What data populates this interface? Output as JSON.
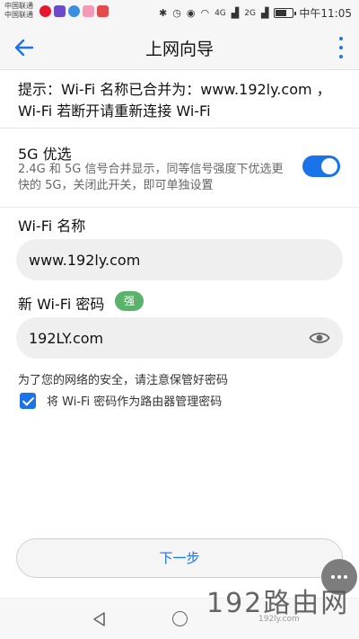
{
  "status_bar": {
    "carrier_1": "中国联通",
    "carrier_2": "中国联通",
    "network_1": "4G",
    "network_2": "2G",
    "time": "中午11:05"
  },
  "app_bar": {
    "title": "上网向导",
    "back_icon": "arrow-left-icon",
    "menu_icon": "more-vertical-icon"
  },
  "tip": "提示：Wi-Fi 名称已合并为：www.192ly.com ，Wi-Fi 若断开请重新连接 Wi-Fi",
  "option_5g": {
    "title": "5G 优选",
    "description": "2.4G 和 5G 信号合并显示，同等信号强度下优选更快的 5G，关闭此开关，即可单独设置",
    "enabled": true
  },
  "wifi_name": {
    "label": "Wi-Fi 名称",
    "value": "www.192ly.com"
  },
  "wifi_password": {
    "label": "新 Wi-Fi 密码",
    "strength": "强",
    "value": "192LY.com",
    "toggle_icon": "eye-icon"
  },
  "hint": "为了您的网络的安全，请注意保管好密码",
  "checkbox": {
    "label": "将 Wi-Fi 密码作为路由器管理密码",
    "checked": true
  },
  "next_button": "下一步",
  "watermark": {
    "big": "192路由网",
    "small": "192ly.com"
  },
  "colors": {
    "accent": "#1a73e8",
    "strength_badge": "#5bb26b"
  }
}
